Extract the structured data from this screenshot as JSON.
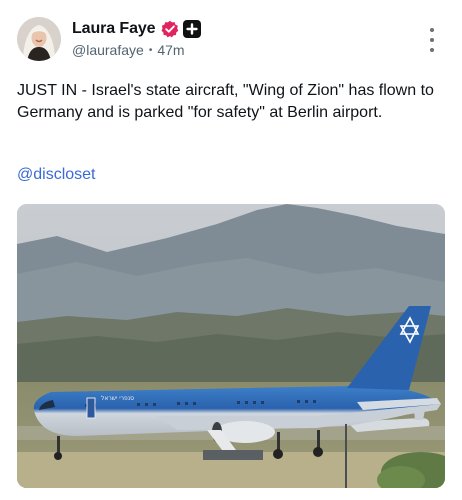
{
  "post": {
    "author": {
      "display_name": "Laura Faye",
      "handle": "@laurafaye",
      "time_ago": "47m",
      "separator": "•",
      "verified_icon": "verified-check-icon",
      "verified_color": "#e0245e",
      "plus_icon": "plus-badge-icon"
    },
    "text": "JUST IN - Israel's state aircraft, \"Wing of Zion\" has flown to Germany and is parked \"for safety\" at Berlin airport.",
    "mention": "@discloset",
    "mention_color": "#3a6ad6",
    "more_icon": "more-vertical-icon",
    "media": {
      "type": "photo",
      "aircraft_livery_text": "סנפרי ישראל"
    }
  }
}
